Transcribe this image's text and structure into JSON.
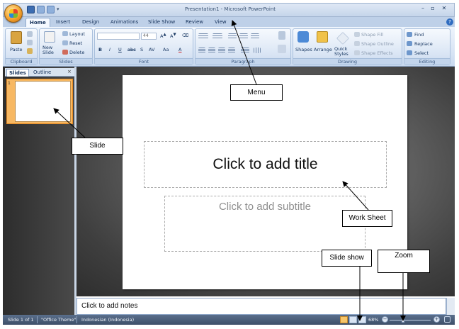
{
  "window": {
    "title": "Presentation1 - Microsoft PowerPoint",
    "controls": [
      "–",
      "▫",
      "✕"
    ]
  },
  "ribbon": {
    "tabs": [
      "Home",
      "Insert",
      "Design",
      "Animations",
      "Slide Show",
      "Review",
      "View"
    ],
    "active_tab": "Home",
    "groups": {
      "clipboard": {
        "label": "Clipboard",
        "paste": "Paste"
      },
      "slides": {
        "label": "Slides",
        "new_slide": "New Slide",
        "layout": "Layout",
        "reset": "Reset",
        "delete": "Delete"
      },
      "font": {
        "label": "Font",
        "size": "44",
        "buttons": [
          "B",
          "I",
          "U",
          "abc",
          "S",
          "AV",
          "Aa",
          "A"
        ]
      },
      "paragraph": {
        "label": "Paragraph"
      },
      "drawing": {
        "label": "Drawing",
        "shapes": "Shapes",
        "arrange": "Arrange",
        "quick_styles": "Quick Styles",
        "shape_fill": "Shape Fill",
        "shape_outline": "Shape Outline",
        "shape_effects": "Shape Effects"
      },
      "editing": {
        "label": "Editing",
        "find": "Find",
        "replace": "Replace",
        "select": "Select"
      }
    }
  },
  "left_pane": {
    "tabs": [
      "Slides",
      "Outline"
    ],
    "active_tab": "Slides",
    "close": "×",
    "thumbnail_number": "1"
  },
  "slide": {
    "title_placeholder": "Click to add title",
    "subtitle_placeholder": "Click to add subtitle"
  },
  "notes": {
    "placeholder": "Click to add notes"
  },
  "status": {
    "slide_info": "Slide 1 of 1",
    "theme": "\"Office Theme\"",
    "language": "Indonesian (Indonesia)",
    "zoom": "68%",
    "zoom_minus": "−",
    "zoom_plus": "+"
  },
  "annotations": {
    "menu": "Menu",
    "slide": "Slide",
    "work_sheet": "Work Sheet",
    "slide_show": "Slide show",
    "zoom": "Zoom"
  },
  "colors": {
    "ribbon_bg": "#d6e3f4",
    "slide_thumb_highlight": "#f7b863",
    "workspace_bg": "#3f3f3f",
    "statusbar_bg": "#3d4f68"
  }
}
